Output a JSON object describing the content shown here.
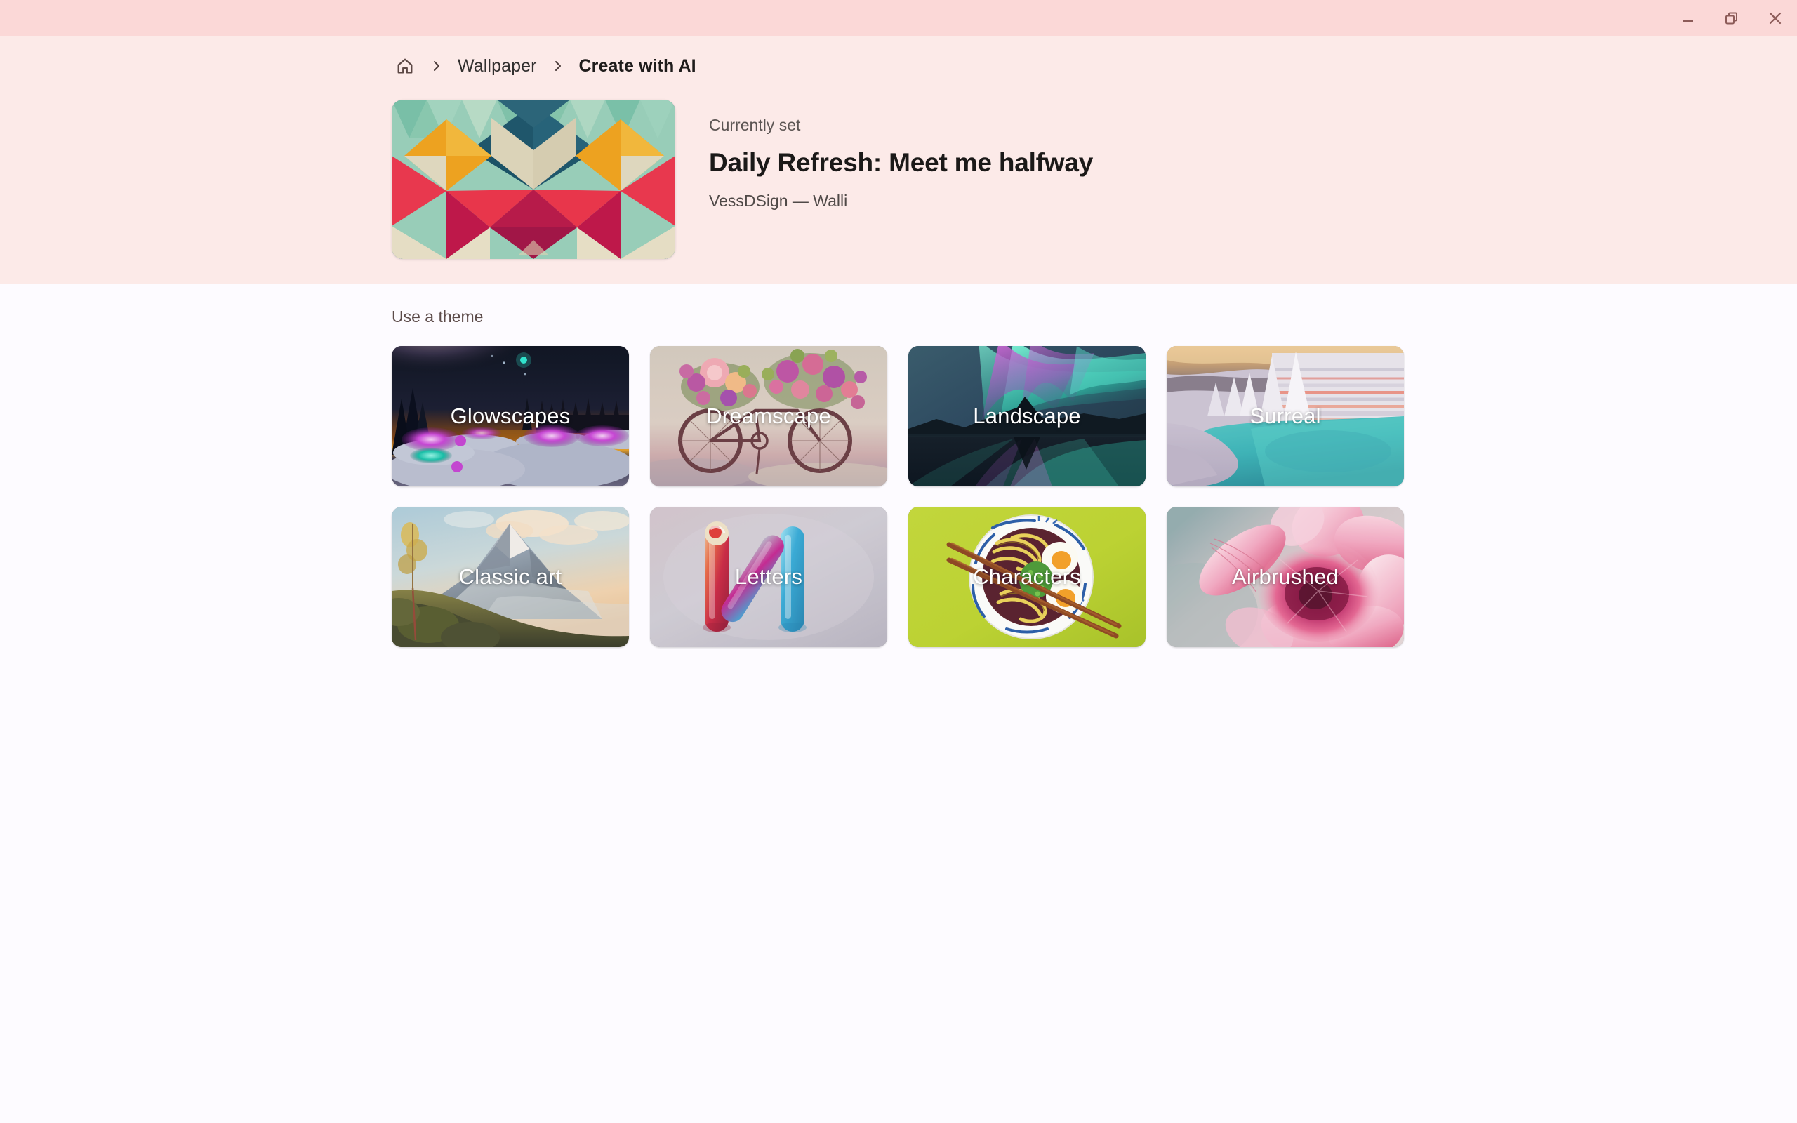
{
  "window": {
    "minimize_label": "Minimize",
    "restore_label": "Restore",
    "close_label": "Close"
  },
  "breadcrumb": {
    "home_icon": "home-icon",
    "separator": "›",
    "items": [
      {
        "label": "Wallpaper",
        "current": false
      },
      {
        "label": "Create with AI",
        "current": true
      }
    ]
  },
  "currently_set": {
    "label": "Currently set",
    "title": "Daily Refresh: Meet me halfway",
    "attribution": "VessDSign — Walli"
  },
  "themes": {
    "section_label": "Use a theme",
    "items": [
      {
        "label": "Glowscapes",
        "art": "glowscapes"
      },
      {
        "label": "Dreamscape",
        "art": "dreamscape"
      },
      {
        "label": "Landscape",
        "art": "landscape"
      },
      {
        "label": "Surreal",
        "art": "surreal"
      },
      {
        "label": "Classic art",
        "art": "classic-art"
      },
      {
        "label": "Letters",
        "art": "letters"
      },
      {
        "label": "Characters",
        "art": "characters"
      },
      {
        "label": "Airbrushed",
        "art": "airbrushed"
      }
    ]
  },
  "colors": {
    "titlebar": "#FBD8D7",
    "hero_background": "#FCEAE8",
    "content_background": "#FDFBFF",
    "text_primary": "#1B1918",
    "text_secondary": "#5C5553",
    "card_label": "#FFFFFF"
  }
}
